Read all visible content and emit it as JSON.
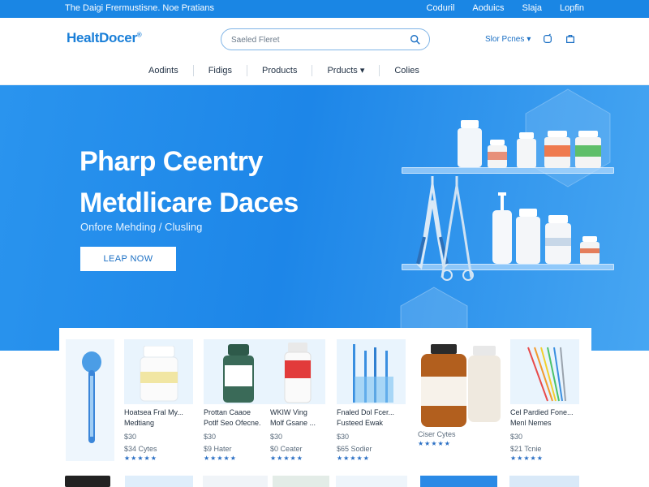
{
  "topbar": {
    "promo": "The Daigi Frermustisne. Noe Pratians",
    "links": [
      "Coduril",
      "Aoduics",
      "Slaja",
      "Lopfin"
    ]
  },
  "header": {
    "logo": "HealtDocer",
    "search_placeholder": "Saeled Fleret",
    "store_label": "Slor Pcnes"
  },
  "nav": {
    "items": [
      "Aodints",
      "Fidigs",
      "Products",
      "Prducts",
      "Colies"
    ]
  },
  "hero": {
    "title_line1": "Pharp Ceentry",
    "title_line2": "Metdlicare Daces",
    "subtitle": "Onfore Mehding / Clusling",
    "cta": "LEAP NOW"
  },
  "products": [
    {
      "name": "Hoatsea Fral My...\nMedtiang",
      "price": "$30",
      "price2": "$34 Cytes",
      "stars": "★★★★★"
    },
    {
      "name": "Prottan Caaoe\nPotlf Seo Ofecne.",
      "price": "$30",
      "price2": "$9 Hater",
      "stars": "★★★★★"
    },
    {
      "name": "WKIW Ving\nMolf Gsane ...",
      "price": "$30",
      "price2": "$0 Ceater",
      "stars": "★★★★★"
    },
    {
      "name": "Fnaled Dol Fcer...\nFusteed Ewak",
      "price": "$30",
      "price2": "$65 Sodier",
      "stars": "★★★★★"
    },
    {
      "name": "",
      "price": "",
      "price2": "Ciser Cytes",
      "stars": "★★★★★"
    },
    {
      "name": "Cel Pardied Fone...\nMenl Nemes",
      "price": "$30",
      "price2": "$21 Tcnie",
      "stars": "★★★★★"
    }
  ]
}
